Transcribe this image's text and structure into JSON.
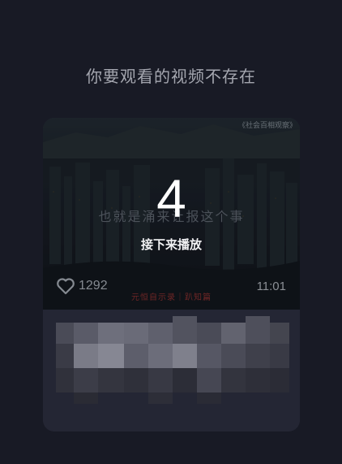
{
  "notice": {
    "text": "你要观看的视频不存在"
  },
  "next_video": {
    "watermark": "《社会百相观察》",
    "subtitle": "也就是涌来让报这个事",
    "countdown": "4",
    "next_label": "接下来播放",
    "likes": "1292",
    "caption": "元恒自示录｜趴知篇",
    "duration": "11:01"
  },
  "icons": {
    "like": "heart-icon"
  },
  "colors": {
    "background": "#181a25",
    "card": "#242634",
    "text_muted": "#a4a6af",
    "countdown": "#ffffff"
  }
}
